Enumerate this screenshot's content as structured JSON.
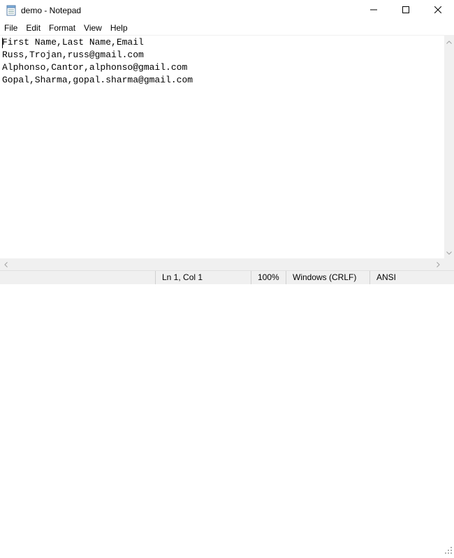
{
  "window": {
    "title": "demo - Notepad",
    "icon": "notepad-icon"
  },
  "menu": {
    "items": [
      "File",
      "Edit",
      "Format",
      "View",
      "Help"
    ]
  },
  "editor": {
    "lines": [
      "First Name,Last Name,Email",
      "Russ,Trojan,russ@gmail.com",
      "Alphonso,Cantor,alphonso@gmail.com",
      "Gopal,Sharma,gopal.sharma@gmail.com"
    ]
  },
  "status": {
    "position": "Ln 1, Col 1",
    "zoom": "100%",
    "line_ending": "Windows (CRLF)",
    "encoding": "ANSI"
  },
  "colors": {
    "background": "#ffffff",
    "chrome": "#f0f0f0",
    "text": "#000000"
  }
}
